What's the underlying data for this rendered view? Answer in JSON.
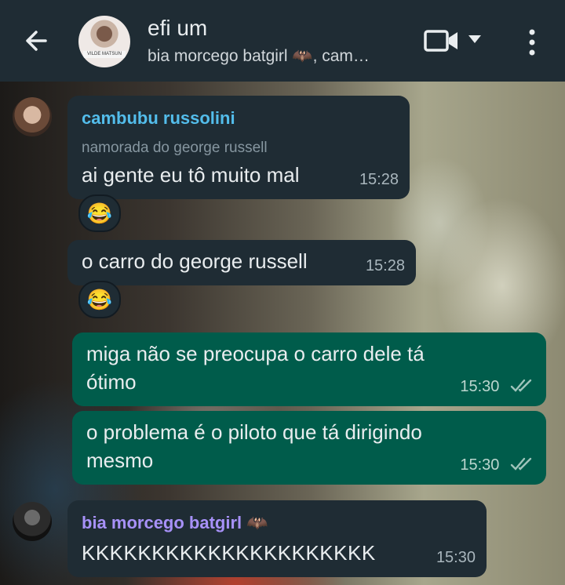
{
  "header": {
    "group_name": "efi um",
    "members": "bia morcego batgirl 🦇, cam…",
    "avatar_caption": "VILDE MATSUN",
    "icons": {
      "back": "arrow-left-icon",
      "video": "video-camera-icon",
      "caret": "caret-down-icon",
      "menu": "more-vertical-icon"
    }
  },
  "messages": [
    {
      "sender": "cambubu russolini",
      "sender_color": "#53bdeb",
      "subtitle": "namorada do george russell",
      "text": "ai gente eu tô muito mal",
      "time": "15:28",
      "reaction": "😂"
    },
    {
      "text": "o carro do george russell",
      "time": "15:28",
      "reaction": "😂"
    },
    {
      "text_line1": "miga não se preocupa o carro dele tá",
      "text_line2": "ótimo",
      "time": "15:30"
    },
    {
      "text_line1": "o problema é o piloto que tá dirigindo",
      "text_line2": "mesmo",
      "time": "15:30"
    },
    {
      "sender": "bia morcego batgirl 🦇",
      "sender_color": "#a791f8",
      "text": "KKKKKKKKKKKKKKKKKKKKK",
      "time": "15:30"
    }
  ],
  "colors": {
    "header_bg": "#1f2c34",
    "incoming_bubble": "#1f2c34",
    "outgoing_bubble": "#005c4b"
  }
}
